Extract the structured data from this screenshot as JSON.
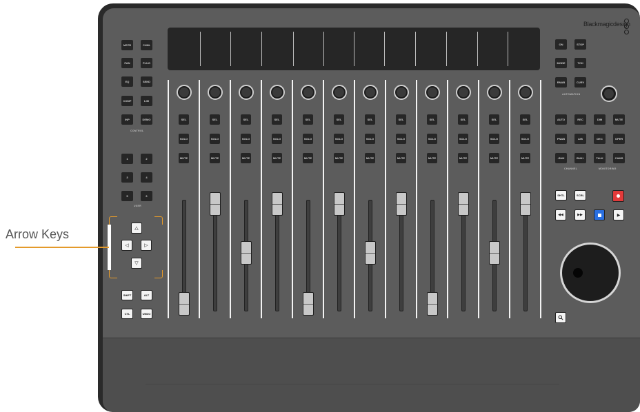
{
  "brand": "Blackmagicdesign",
  "callout": {
    "label": "Arrow Keys"
  },
  "control_keys": [
    "MSTR",
    "CHNL",
    "PAN",
    "PLUG",
    "EQ",
    "SEND",
    "COMP",
    "LIM",
    "INP",
    "DEMO"
  ],
  "control_label": "CONTROL",
  "user_keys": [
    "1",
    "2",
    "3",
    "4",
    "5",
    "6"
  ],
  "user_label": "USER",
  "arrows": {
    "up": "△",
    "left": "◁",
    "right": "▷",
    "down": "▽"
  },
  "modifiers": [
    "SHIFT",
    "ALT",
    "CTL",
    "UNDO"
  ],
  "strip_labels": {
    "sel": "SEL",
    "solo": "SOLO",
    "mute": "MUTE"
  },
  "automation_keys": [
    "ON",
    "STOP",
    "MODE",
    "TCH",
    "RNAB",
    "CURV"
  ],
  "automation_label": "AUTOMATION",
  "channel_keys": [
    "AUTO",
    "REC",
    "DIM",
    "MUTE",
    "PNAB",
    "A/B",
    "DEC",
    "OPER",
    "-BNK",
    "BNK+",
    "TALK",
    "CAMS"
  ],
  "channel_label": "CHANNEL",
  "monitoring_label": "MONITORING",
  "transport": {
    "shtl": "SHTL",
    "scrl": "SCRL",
    "rewind": "◀◀",
    "ffwd": "▶▶",
    "play": "▶"
  },
  "icons": [
    "record-icon",
    "stop-icon",
    "play-icon",
    "rewind-icon",
    "fast-forward-icon",
    "search-icon",
    "jog-wheel-icon"
  ],
  "colors": {
    "accent": "#e49a2a",
    "record": "#e23a3a",
    "stop": "#2a6fe0",
    "panel": "#5c5c5c",
    "display": "#262626"
  }
}
